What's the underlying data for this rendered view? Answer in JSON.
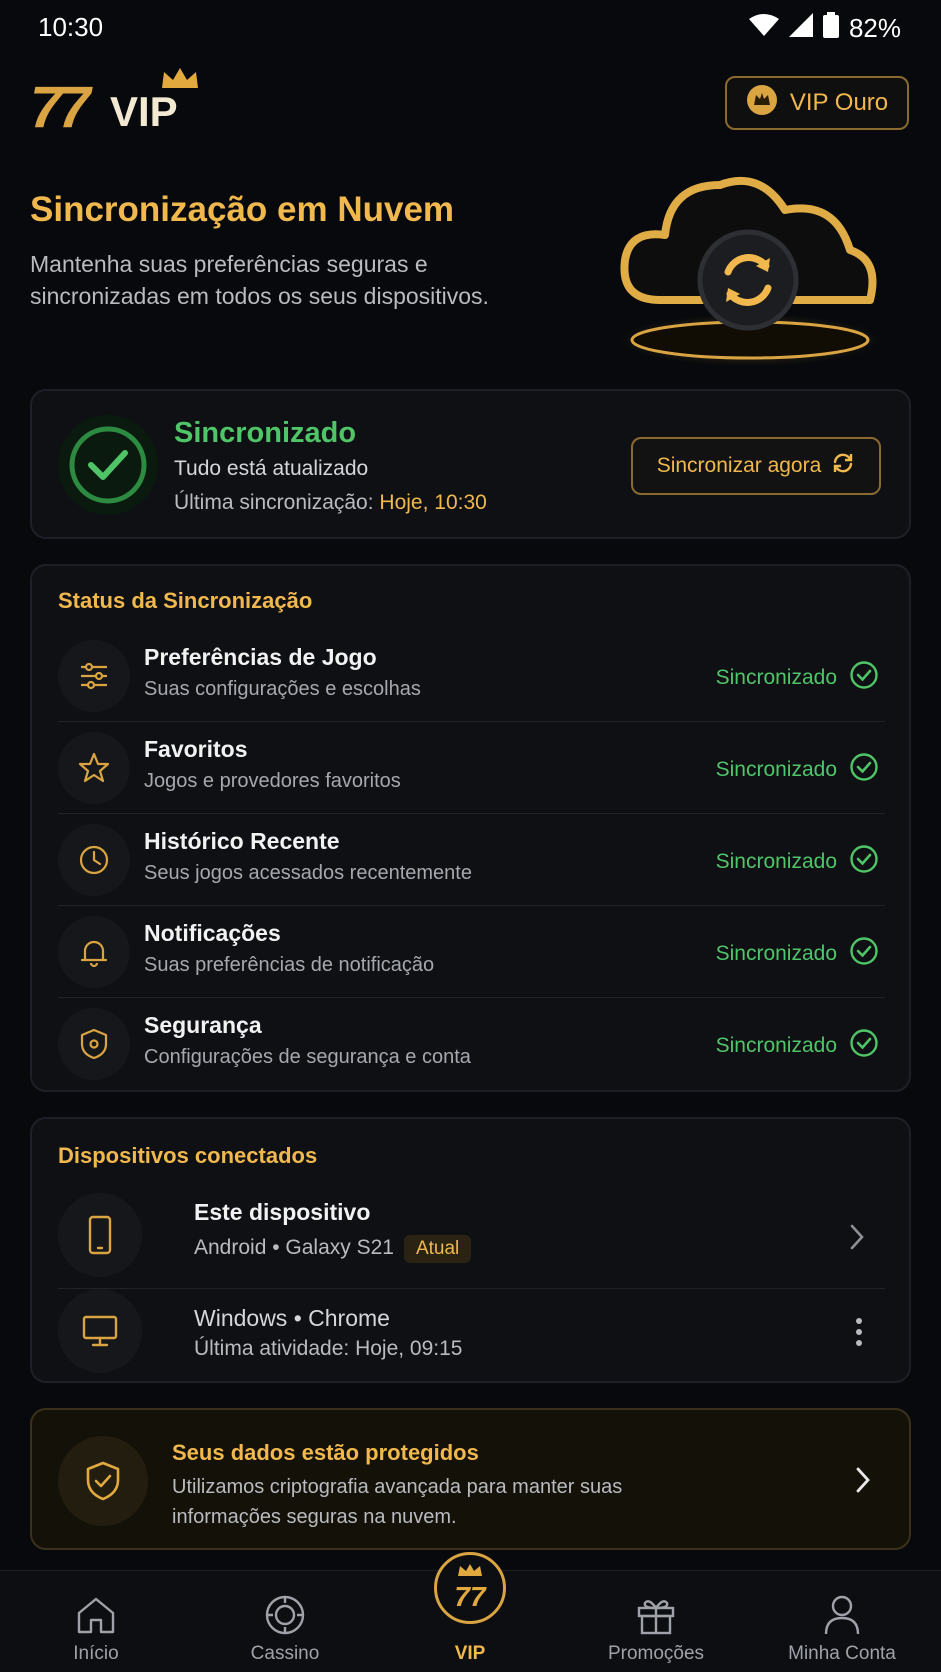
{
  "status_bar": {
    "time": "10:30",
    "battery": "82%"
  },
  "header": {
    "logo_number": "77",
    "logo_text": "VIP",
    "vip_badge": "VIP Ouro"
  },
  "hero": {
    "title": "Sincronização em Nuvem",
    "subtitle": "Mantenha suas preferências seguras e sincronizadas em todos os seus dispositivos."
  },
  "sync_card": {
    "title": "Sincronizado",
    "line1": "Tudo está atualizado",
    "last_sync_label": "Última sincronização: ",
    "last_sync_value": "Hoje, 10:30",
    "button": "Sincronizar agora"
  },
  "status_section": {
    "title": "Status da Sincronização",
    "items": [
      {
        "icon": "sliders-icon",
        "title": "Preferências de Jogo",
        "subtitle": "Suas configurações e escolhas",
        "status": "Sincronizado"
      },
      {
        "icon": "star-icon",
        "title": "Favoritos",
        "subtitle": "Jogos e provedores favoritos",
        "status": "Sincronizado"
      },
      {
        "icon": "clock-icon",
        "title": "Histórico Recente",
        "subtitle": "Seus jogos acessados recentemente",
        "status": "Sincronizado"
      },
      {
        "icon": "bell-icon",
        "title": "Notificações",
        "subtitle": "Suas preferências de notificação",
        "status": "Sincronizado"
      },
      {
        "icon": "shield-icon",
        "title": "Segurança",
        "subtitle": "Configurações de segurança e conta",
        "status": "Sincronizado"
      }
    ]
  },
  "devices": {
    "title": "Dispositivos conectados",
    "items": [
      {
        "icon": "phone-icon",
        "title": "Este dispositivo",
        "subtitle": "Android • Galaxy S21",
        "tag": "Atual"
      },
      {
        "icon": "monitor-icon",
        "title": "Windows • Chrome",
        "subtitle": "Última atividade: Hoje, 09:15"
      }
    ]
  },
  "protect": {
    "title": "Seus dados estão protegidos",
    "text": "Utilizamos criptografia avançada para manter suas informações seguras na nuvem."
  },
  "bottom_nav": {
    "items": [
      {
        "label": "Início",
        "icon": "home-icon"
      },
      {
        "label": "Cassino",
        "icon": "chip-icon"
      },
      {
        "label": "VIP",
        "icon": "vip-77-icon"
      },
      {
        "label": "Promoções",
        "icon": "gift-icon"
      },
      {
        "label": "Minha Conta",
        "icon": "user-icon"
      }
    ]
  },
  "colors": {
    "accent": "#f1b84e",
    "success": "#4fc567",
    "background": "#07090c"
  }
}
